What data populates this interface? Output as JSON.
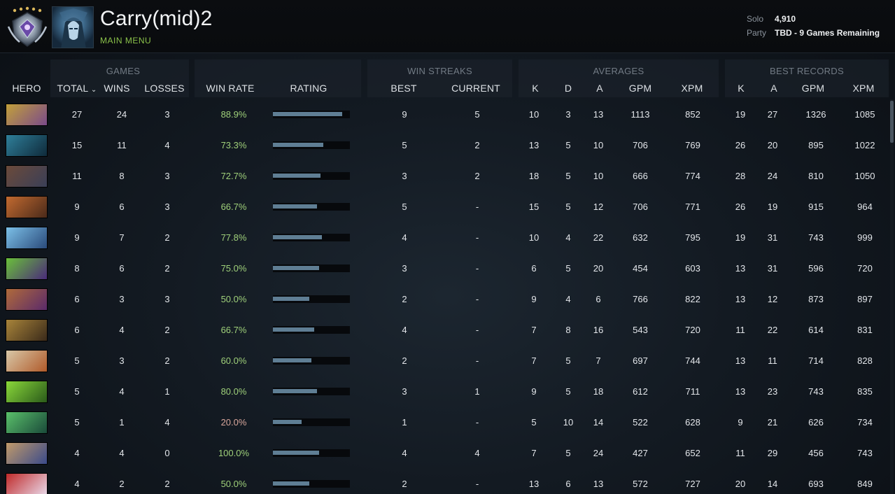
{
  "profile": {
    "name": "Carry(mid)2",
    "menu_link": "MAIN MENU"
  },
  "mmr": {
    "solo_label": "Solo",
    "solo_value": "4,910",
    "party_label": "Party",
    "party_value": "TBD - 9 Games Remaining"
  },
  "groups": {
    "games": "GAMES",
    "win_streaks": "WIN STREAKS",
    "averages": "AVERAGES",
    "best_records": "BEST RECORDS"
  },
  "columns": {
    "hero": "HERO",
    "total": "TOTAL",
    "sort_indicator": "⌄",
    "wins": "WINS",
    "losses": "LOSSES",
    "win_rate": "WIN RATE",
    "rating": "RATING",
    "best": "BEST",
    "current": "CURRENT",
    "avg_k": "K",
    "avg_d": "D",
    "avg_a": "A",
    "avg_gpm": "GPM",
    "avg_xpm": "XPM",
    "best_k": "K",
    "best_a": "A",
    "best_gpm": "GPM",
    "best_xpm": "XPM"
  },
  "rows": [
    {
      "total": "27",
      "wins": "24",
      "losses": "3",
      "win_rate": "88.9%",
      "rating": 0.92,
      "best": "9",
      "current": "5",
      "k": "10",
      "d": "3",
      "a": "13",
      "gpm": "1113",
      "xpm": "852",
      "bk": "19",
      "ba": "27",
      "bgpm": "1326",
      "bxpm": "1085",
      "c1": "#c2a03a",
      "c2": "#7a4a8a"
    },
    {
      "total": "15",
      "wins": "11",
      "losses": "4",
      "win_rate": "73.3%",
      "rating": 0.67,
      "best": "5",
      "current": "2",
      "k": "13",
      "d": "5",
      "a": "10",
      "gpm": "706",
      "xpm": "769",
      "bk": "26",
      "ba": "20",
      "bgpm": "895",
      "bxpm": "1022",
      "c1": "#2f7f9a",
      "c2": "#0f2a3a"
    },
    {
      "total": "11",
      "wins": "8",
      "losses": "3",
      "win_rate": "72.7%",
      "rating": 0.63,
      "best": "3",
      "current": "2",
      "k": "18",
      "d": "5",
      "a": "10",
      "gpm": "666",
      "xpm": "774",
      "bk": "28",
      "ba": "24",
      "bgpm": "810",
      "bxpm": "1050",
      "c1": "#6b4a3a",
      "c2": "#3a3f57"
    },
    {
      "total": "9",
      "wins": "6",
      "losses": "3",
      "win_rate": "66.7%",
      "rating": 0.58,
      "best": "5",
      "current": "-",
      "k": "15",
      "d": "5",
      "a": "12",
      "gpm": "706",
      "xpm": "771",
      "bk": "26",
      "ba": "19",
      "bgpm": "915",
      "bxpm": "964",
      "c1": "#c26a30",
      "c2": "#4a2a1a"
    },
    {
      "total": "9",
      "wins": "7",
      "losses": "2",
      "win_rate": "77.8%",
      "rating": 0.65,
      "best": "4",
      "current": "-",
      "k": "10",
      "d": "4",
      "a": "22",
      "gpm": "632",
      "xpm": "795",
      "bk": "19",
      "ba": "31",
      "bgpm": "743",
      "bxpm": "999",
      "c1": "#7cc0e8",
      "c2": "#2a4a7a"
    },
    {
      "total": "8",
      "wins": "6",
      "losses": "2",
      "win_rate": "75.0%",
      "rating": 0.61,
      "best": "3",
      "current": "-",
      "k": "6",
      "d": "5",
      "a": "20",
      "gpm": "454",
      "xpm": "603",
      "bk": "13",
      "ba": "31",
      "bgpm": "596",
      "bxpm": "720",
      "c1": "#6ac03a",
      "c2": "#4a2a7a"
    },
    {
      "total": "6",
      "wins": "3",
      "losses": "3",
      "win_rate": "50.0%",
      "rating": 0.48,
      "best": "2",
      "current": "-",
      "k": "9",
      "d": "4",
      "a": "6",
      "gpm": "766",
      "xpm": "822",
      "bk": "13",
      "ba": "12",
      "bgpm": "873",
      "bxpm": "897",
      "c1": "#b06a3a",
      "c2": "#5a2a6a"
    },
    {
      "total": "6",
      "wins": "4",
      "losses": "2",
      "win_rate": "66.7%",
      "rating": 0.55,
      "best": "4",
      "current": "-",
      "k": "7",
      "d": "8",
      "a": "16",
      "gpm": "543",
      "xpm": "720",
      "bk": "11",
      "ba": "22",
      "bgpm": "614",
      "bxpm": "831",
      "c1": "#a8843a",
      "c2": "#3a2a1a"
    },
    {
      "total": "5",
      "wins": "3",
      "losses": "2",
      "win_rate": "60.0%",
      "rating": 0.51,
      "best": "2",
      "current": "-",
      "k": "7",
      "d": "5",
      "a": "7",
      "gpm": "697",
      "xpm": "744",
      "bk": "13",
      "ba": "11",
      "bgpm": "714",
      "bxpm": "828",
      "c1": "#d8c8a8",
      "c2": "#b05a2a"
    },
    {
      "total": "5",
      "wins": "4",
      "losses": "1",
      "win_rate": "80.0%",
      "rating": 0.58,
      "best": "3",
      "current": "1",
      "k": "9",
      "d": "5",
      "a": "18",
      "gpm": "612",
      "xpm": "711",
      "bk": "13",
      "ba": "23",
      "bgpm": "743",
      "bxpm": "835",
      "c1": "#8ad83a",
      "c2": "#2a5a1a"
    },
    {
      "total": "5",
      "wins": "1",
      "losses": "4",
      "win_rate": "20.0%",
      "rating": 0.38,
      "best": "1",
      "current": "-",
      "k": "5",
      "d": "10",
      "a": "14",
      "gpm": "522",
      "xpm": "628",
      "bk": "9",
      "ba": "21",
      "bgpm": "626",
      "bxpm": "734",
      "c1": "#5ac06a",
      "c2": "#1a4a3a"
    },
    {
      "total": "4",
      "wins": "4",
      "losses": "0",
      "win_rate": "100.0%",
      "rating": 0.61,
      "best": "4",
      "current": "4",
      "k": "7",
      "d": "5",
      "a": "24",
      "gpm": "427",
      "xpm": "652",
      "bk": "11",
      "ba": "29",
      "bgpm": "456",
      "bxpm": "743",
      "c1": "#c09a6a",
      "c2": "#3a4a8a"
    },
    {
      "total": "4",
      "wins": "2",
      "losses": "2",
      "win_rate": "50.0%",
      "rating": 0.48,
      "best": "2",
      "current": "-",
      "k": "13",
      "d": "6",
      "a": "13",
      "gpm": "572",
      "xpm": "727",
      "bk": "20",
      "ba": "14",
      "bgpm": "693",
      "bxpm": "849",
      "c1": "#c02a2a",
      "c2": "#e8d8e8"
    }
  ],
  "colors": {
    "accent_green": "#8bc24a",
    "winrate_good": "#9fd07a",
    "winrate_bad": "#d9a79c",
    "rating_bar": "#5f7e94"
  }
}
